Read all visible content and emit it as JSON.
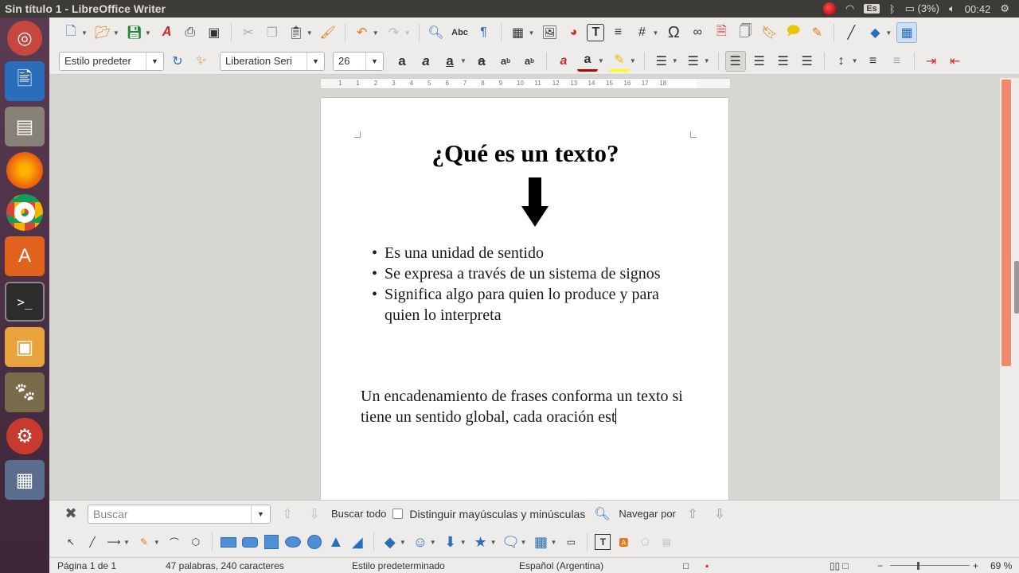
{
  "window": {
    "title": "Sin título 1 - LibreOffice Writer"
  },
  "tray": {
    "keyboard": "Es",
    "battery": "(3%)",
    "time": "00:42"
  },
  "toolbar": {
    "paragraph_style": "Estilo predeter",
    "font_name": "Liberation Seri",
    "font_size": "26"
  },
  "ruler": {
    "ticks": [
      "1",
      "1",
      "2",
      "3",
      "4",
      "5",
      "6",
      "7",
      "8",
      "9",
      "10",
      "11",
      "12",
      "13",
      "14",
      "15",
      "16",
      "17",
      "18"
    ]
  },
  "document": {
    "title": "¿Qué es un texto?",
    "bullets": [
      "Es una unidad de sentido",
      "Se expresa a través de un sistema de signos",
      "Significa algo para quien lo produce y para quien lo interpreta"
    ],
    "paragraph": "Un encadenamiento de frases conforma un texto si tiene un sentido global, cada oración est"
  },
  "findbar": {
    "placeholder": "Buscar",
    "find_all": "Buscar todo",
    "match_case": "Distinguir mayúsculas y minúsculas",
    "navigate_by": "Navegar por"
  },
  "status": {
    "page": "Página 1 de 1",
    "words": "47 palabras, 240 caracteres",
    "style": "Estilo predeterminado",
    "language": "Español (Argentina)",
    "zoom": "69 %"
  }
}
